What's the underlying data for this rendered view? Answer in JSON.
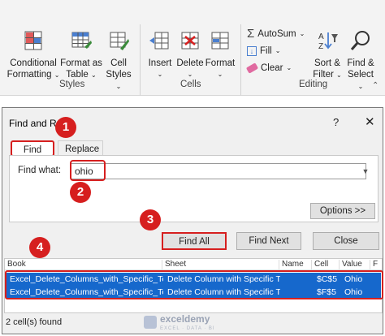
{
  "ribbon": {
    "styles": {
      "conditional_formatting": [
        "Conditional",
        "Formatting"
      ],
      "format_as_table": [
        "Format as",
        "Table"
      ],
      "cell_styles": [
        "Cell",
        "Styles"
      ],
      "group_label": "Styles"
    },
    "cells": {
      "insert": "Insert",
      "delete": "Delete",
      "format": "Format",
      "group_label": "Cells"
    },
    "editing": {
      "autosum": "AutoSum",
      "fill": "Fill",
      "clear": "Clear",
      "sort_filter": [
        "Sort &",
        "Filter"
      ],
      "find_select": [
        "Find &",
        "Select"
      ],
      "group_label": "Editing"
    }
  },
  "dialog": {
    "title": "Find and Re",
    "help": "?",
    "close_glyph": "✕",
    "tabs": [
      "Find",
      "Replace"
    ],
    "find_what_label": "Find what:",
    "find_what_value": "ohio",
    "options_label": "Options >>",
    "buttons": {
      "find_all": "Find All",
      "find_next": "Find Next",
      "close": "Close"
    },
    "results": {
      "columns": [
        "Book",
        "Sheet",
        "Name",
        "Cell",
        "Value",
        "F"
      ],
      "rows": [
        [
          "Excel_Delete_Columns_with_Specific_Text.xlsx",
          "Delete Column with Specific Tex",
          "",
          "$C$5",
          "Ohio"
        ],
        [
          "Excel_Delete_Columns_with_Specific_Text.xlsx",
          "Delete Column with Specific Tex",
          "",
          "$F$5",
          "Ohio"
        ]
      ]
    },
    "status": "2 cell(s) found"
  },
  "watermark": {
    "name": "exceldemy",
    "tagline": "EXCEL · DATA · BI"
  },
  "steps": [
    "1",
    "2",
    "3",
    "4"
  ],
  "colors": {
    "annotation_red": "#d61f1f",
    "selection_blue": "#1668cc"
  }
}
